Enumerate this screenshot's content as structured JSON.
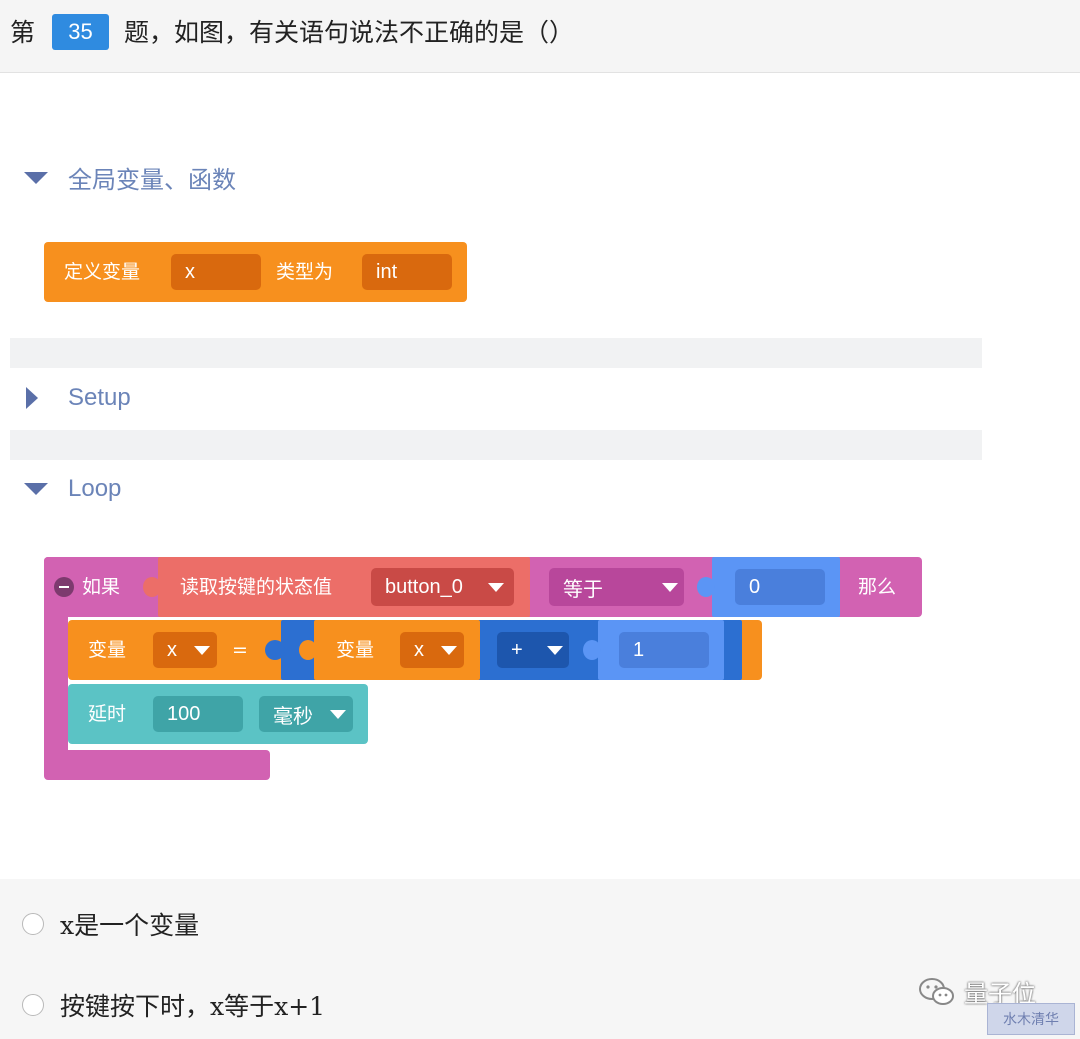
{
  "question": {
    "prefix": "第",
    "number": "35",
    "text": "题，如图，有关语句说法不正确的是（）"
  },
  "categories": {
    "globals": "全局变量、函数",
    "setup": "Setup",
    "loop": "Loop"
  },
  "define_block": {
    "label": "定义变量",
    "var_name": "x",
    "type_label": "类型为",
    "type_value": "int"
  },
  "if_block": {
    "label": "如果",
    "read_label": "读取按键的状态值",
    "button_value": "button_0",
    "compare_op": "等于",
    "compare_value": "0",
    "then_label": "那么"
  },
  "assign_block": {
    "label": "变量",
    "var_name": "x",
    "equals": "=",
    "inner_label": "变量",
    "inner_var": "x",
    "op": "+",
    "operand": "1"
  },
  "delay_block": {
    "label": "延时",
    "value": "100",
    "unit": "毫秒"
  },
  "options": [
    {
      "text": "x是一个变量"
    },
    {
      "text": "按键按下时，x等于x+1"
    }
  ],
  "watermark": {
    "icon": "wechat-icon",
    "text": "量子位",
    "stamp": "水木清华"
  },
  "colors": {
    "orange": "#f7901e",
    "pink": "#d262b2",
    "salmon": "#ec6e68",
    "blue_light": "#5b95f5",
    "blue_dark": "#2c6fd1",
    "teal": "#5bc3c5",
    "accent": "#2f8be0"
  }
}
